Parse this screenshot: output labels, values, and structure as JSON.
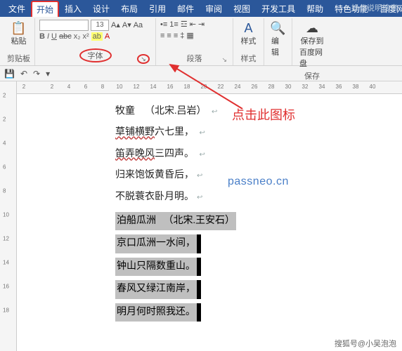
{
  "menu": {
    "tabs": [
      "文件",
      "开始",
      "插入",
      "设计",
      "布局",
      "引用",
      "邮件",
      "审阅",
      "视图",
      "开发工具",
      "帮助",
      "特色功能",
      "百度网盘"
    ],
    "active_index": 1,
    "help_hint": "操作说明搜索"
  },
  "ribbon": {
    "clipboard": {
      "paste": "粘贴",
      "label": "剪贴板"
    },
    "font": {
      "row1": {
        "bold": "B",
        "italic": "I",
        "underline": "U",
        "strike": "abc",
        "sub": "x₂",
        "sup": "x²"
      },
      "size": "13",
      "label": "字体"
    },
    "paragraph": {
      "label": "段落"
    },
    "styles": {
      "label": "样式",
      "big": "A"
    },
    "editing": {
      "label": "编辑"
    },
    "save": {
      "label1": "保存到",
      "label2": "百度网盘",
      "group": "保存"
    }
  },
  "qat": {
    "undo": "↶",
    "save": "💾",
    "redo": "↷",
    "dd": "▾"
  },
  "ruler": {
    "h": [
      "2",
      "",
      "2",
      "4",
      "6",
      "8",
      "10",
      "12",
      "14",
      "16",
      "18",
      "20",
      "22",
      "24",
      "26",
      "28",
      "30",
      "32",
      "34",
      "36",
      "38",
      "40"
    ],
    "v": [
      "",
      "2",
      "",
      "2",
      "4",
      "6",
      "8",
      "10",
      "12",
      "14",
      "16",
      "18"
    ]
  },
  "doc": {
    "poem1": {
      "title_a": "牧童",
      "title_b": "（北宋.吕岩）",
      "l1a": "草铺横野",
      "l1b": "六七里，",
      "l2a": "笛弄晚风",
      "l2b": "三四声。",
      "l3": "归来饱饭黄昏后，",
      "l4": "不脱蓑衣卧月明。"
    },
    "poem2": {
      "title_a": "泊船瓜洲",
      "title_b": "（北宋.王安石）",
      "l1": "京口瓜洲一水间，",
      "l2": "钟山只隔数重山。",
      "l3": "春风又绿江南岸，",
      "l4": "明月何时照我还。"
    }
  },
  "annotation": {
    "text": "点击此图标"
  },
  "watermark": "passneo.cn",
  "credit": "搜狐号@小吴泡泡"
}
